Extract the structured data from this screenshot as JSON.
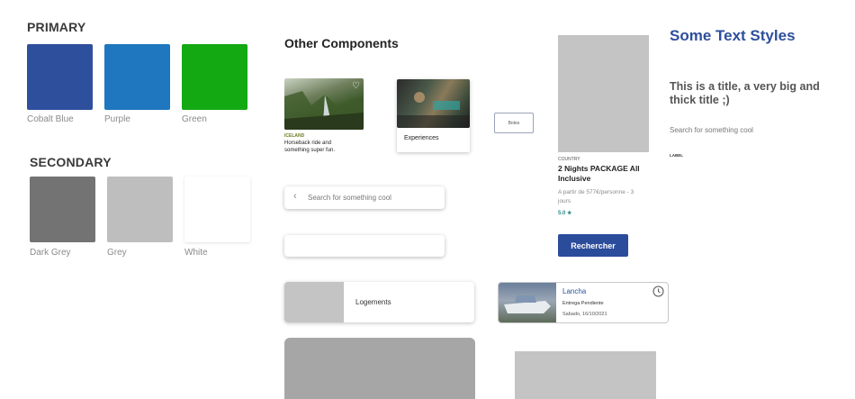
{
  "colors": {
    "primary_title": "PRIMARY",
    "primary": [
      {
        "name": "Cobalt Blue",
        "hex": "#2e4f9c"
      },
      {
        "name": "Purple",
        "hex": "#1e77bf"
      },
      {
        "name": "Green",
        "hex": "#13a913"
      }
    ],
    "secondary_title": "SECONDARY",
    "secondary": [
      {
        "name": "Dark Grey",
        "hex": "#737373"
      },
      {
        "name": "Grey",
        "hex": "#bebebe"
      },
      {
        "name": "White",
        "hex": "#ffffff"
      }
    ]
  },
  "components": {
    "title": "Other Components",
    "iceland_card": {
      "tag": "ICELAND",
      "title": "Horseback ride and something super fun."
    },
    "experiences_card": {
      "label": "Experiences"
    },
    "small_button": {
      "label": "Botes"
    },
    "search": {
      "placeholder": "Search for something cool"
    },
    "logements": {
      "label": "Logements"
    },
    "lancha": {
      "title": "Lancha",
      "status": "Entrega Pendiente",
      "date": "Sabado, 16/10/2021"
    },
    "package": {
      "country": "COUNTRY",
      "title": "2 Nights PACKAGE All Inclusive",
      "price": "A partir de 577€/personne - 3 jours",
      "rating": "5.0 ★",
      "button": "Rechercher"
    }
  },
  "text_styles": {
    "heading": "Some Text Styles",
    "big_title": "This is a title, a very big and thick title ;)",
    "body": "Search for something cool",
    "label": "LABEL"
  },
  "accent": "#2e4f9c",
  "rating_color": "#2a8a8a"
}
